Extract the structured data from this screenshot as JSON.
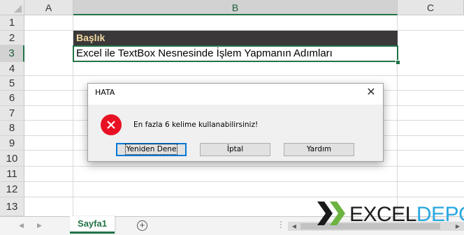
{
  "columns": [
    "A",
    "B",
    "C"
  ],
  "rows": [
    "1",
    "2",
    "3",
    "4",
    "5",
    "6",
    "7",
    "8",
    "9",
    "10",
    "11",
    "12",
    "13"
  ],
  "cells": {
    "b2": "Başlık",
    "b3": "Excel ile TextBox Nesnesinde İşlem Yapmanın Adımları"
  },
  "dialog": {
    "title": "HATA",
    "close_label": "✕",
    "message": "En fazla 6 kelime kullanabilirsiniz!",
    "icon": "error-icon",
    "buttons": [
      {
        "label": "Yeniden Dene"
      },
      {
        "label": "İptal"
      },
      {
        "label": "Yardım"
      }
    ]
  },
  "sheet_tabs": {
    "nav_prev": "◀",
    "nav_next": "▶",
    "active": "Sayfa1",
    "add_label": "+",
    "more": "⋮"
  },
  "scrollbar": {
    "left_arrow": "◀",
    "right_arrow": "▶"
  },
  "watermark": {
    "text_dark": "EXCEL",
    "text_blue": "DEPO"
  },
  "colors": {
    "accent": "#217346",
    "header_fill": "#3a3838",
    "header_text": "#f2d9a0",
    "error": "#e81123"
  }
}
